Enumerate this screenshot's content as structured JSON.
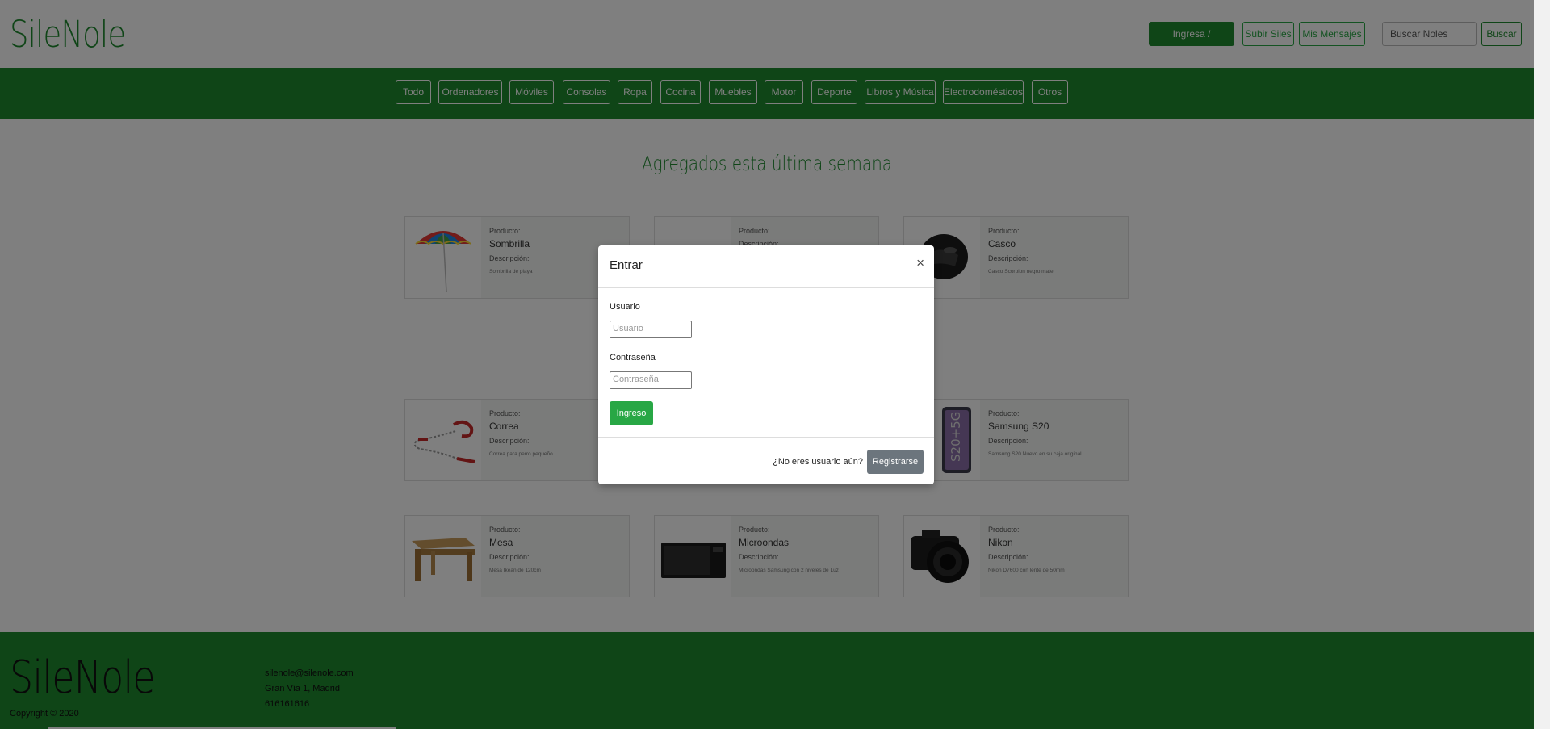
{
  "header": {
    "logo": "SileNole",
    "login_button": "Ingresa / Registrate",
    "subir_button": "Subir Siles",
    "mensajes_button": "Mis Mensajes",
    "search_placeholder": "Buscar Noles",
    "search_button": "Buscar"
  },
  "nav": {
    "items": [
      "Todo",
      "Ordenadores",
      "Móviles",
      "Consolas",
      "Ropa",
      "Cocina",
      "Muebles",
      "Motor",
      "Deporte",
      "Libros y Música",
      "Electrodomésticos",
      "Otros"
    ]
  },
  "main": {
    "title": "Agregados esta última semana",
    "product_label": "Producto:",
    "description_label": "Descripción:",
    "cards": [
      {
        "name": "Sombrilla",
        "description": "Sombrilla de playa",
        "icon": "umbrella-image"
      },
      {
        "name": "",
        "description": "",
        "icon": "product-image"
      },
      {
        "name": "Casco",
        "description": "Casco Scorpion negro mate",
        "icon": "helmet-image"
      },
      {
        "name": "Correa",
        "description": "Correa para perro pequeño",
        "icon": "leash-image"
      },
      {
        "name": "Samsung S20",
        "description": "Samsung S20 Nuevo en su caja original",
        "icon": "phone-image"
      },
      {
        "name": "Mesa",
        "description": "Mesa Ikean de 120cm",
        "icon": "table-image"
      },
      {
        "name": "Microondas",
        "description": "Microondas Samsung con 2 niveles de Luz",
        "icon": "microwave-image"
      },
      {
        "name": "Nikon",
        "description": "Nikon D7600 con lente de 50mm",
        "icon": "camera-image"
      }
    ]
  },
  "footer": {
    "logo": "SileNole",
    "copyright": "Copyright © 2020",
    "email": "silenole@silenole.com",
    "address": "Gran Vía 1, Madrid",
    "phone": "616161616"
  },
  "modal": {
    "title": "Entrar",
    "close": "×",
    "user_label": "Usuario",
    "user_placeholder": "Usuario",
    "password_label": "Contraseña",
    "password_placeholder": "Contraseña",
    "submit_button": "Ingreso",
    "register_question": "¿No eres usuario aún?",
    "register_button": "Registrarse"
  },
  "colors": {
    "brand_green": "#1e8a2e",
    "button_green": "#28a745",
    "secondary_gray": "#6c757d"
  }
}
